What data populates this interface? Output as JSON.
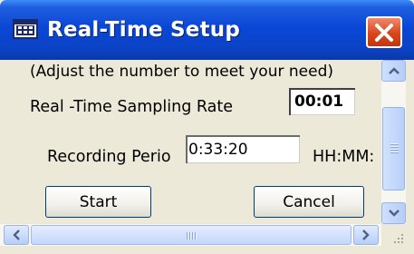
{
  "window": {
    "title": "Real-Time Setup",
    "icon": "table-window-icon",
    "close_icon": "close-x-icon"
  },
  "form": {
    "note": "(Adjust the number to meet your need)",
    "sampling_rate_label": "Real -Time Sampling Rate",
    "sampling_rate_value": "00:01",
    "recording_period_label": "Recording Perio",
    "recording_period_value": "0:33:20",
    "units_label": "HH:MM:"
  },
  "buttons": {
    "start": "Start",
    "cancel": "Cancel"
  },
  "scrollbars": {
    "vertical_icons": [
      "chevron-up-icon",
      "chevron-down-icon"
    ],
    "horizontal_icons": [
      "chevron-left-icon",
      "chevron-right-icon"
    ]
  },
  "colors": {
    "titlebar": "#0a47d6",
    "close_button": "#d8461c",
    "dialog_bg": "#ece9d8",
    "scrollbar": "#b9cff7"
  }
}
